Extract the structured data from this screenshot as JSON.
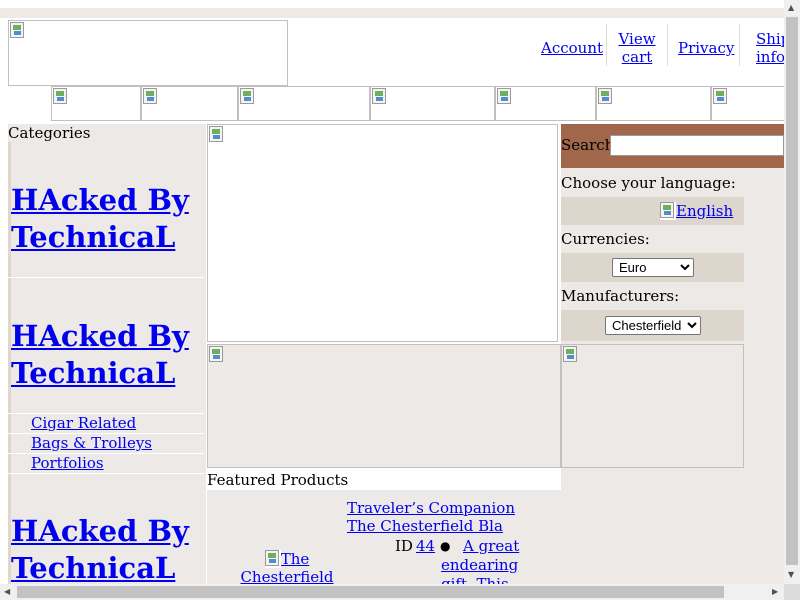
{
  "nav": {
    "account": "Account",
    "view_cart": "View cart",
    "privacy": "Privacy",
    "shipping": "Shipping info"
  },
  "categories": {
    "title": "Categories",
    "hacked_text": "HAcked By TechnicaL",
    "subcategories": [
      "Cigar Related",
      "Bags & Trolleys",
      "Portfolios"
    ]
  },
  "search": {
    "label": "Search:",
    "value": ""
  },
  "language": {
    "label": "Choose your language:",
    "selected": "English"
  },
  "currencies": {
    "label": "Currencies:",
    "selected": "Euro"
  },
  "manufacturers": {
    "label": "Manufacturers:",
    "selected": "Chesterfield"
  },
  "featured": {
    "title": "Featured Products",
    "product_title_1": "Traveler’s Companion",
    "product_title_2": "The Chesterfield Bla",
    "id_label": "ID",
    "id_value": "44",
    "image_alt": "The Chesterfield Black Umbrella",
    "bullet_text": "A great endearing gift. This black u"
  }
}
